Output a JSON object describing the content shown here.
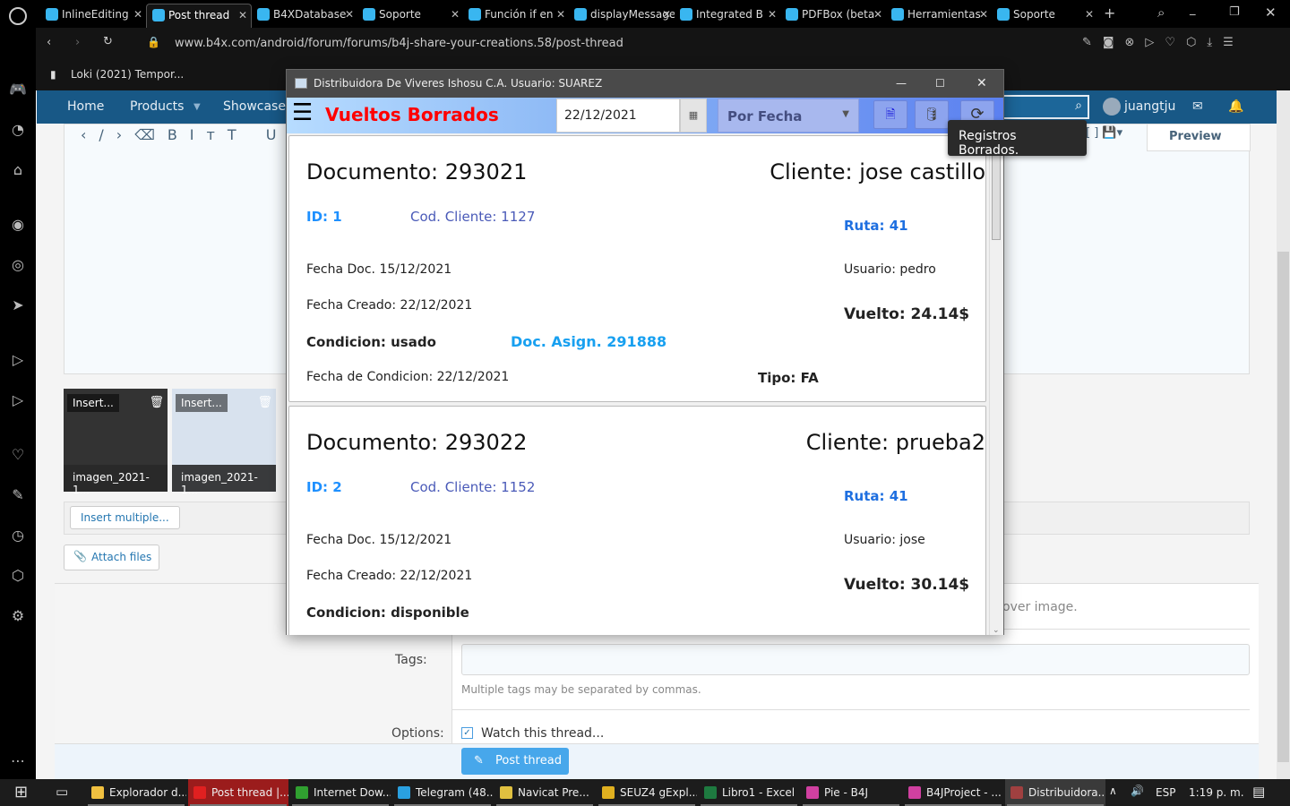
{
  "browser": {
    "tabs": [
      {
        "label": "InlineEditing",
        "icon": "b4x-icon"
      },
      {
        "label": "Post thread",
        "icon": "b4x-icon",
        "active": true
      },
      {
        "label": "B4XDatabase",
        "icon": "b4x-icon"
      },
      {
        "label": "Soporte",
        "icon": "soporte-icon"
      },
      {
        "label": "Función if en",
        "icon": "avatar-icon"
      },
      {
        "label": "displayMessage",
        "icon": "b4x-icon"
      },
      {
        "label": "Integrated B",
        "icon": "b4x-icon"
      },
      {
        "label": "PDFBox (beta",
        "icon": "b4x-icon"
      },
      {
        "label": "Herramientas",
        "icon": "tool-icon"
      },
      {
        "label": "Soporte",
        "icon": "soporte-icon"
      }
    ],
    "url": "www.b4x.com/android/forum/forums/b4j-share-your-creations.58/post-thread",
    "bookmark": "Loki (2021) Tempor..."
  },
  "forum": {
    "nav": [
      "Home",
      "Products",
      "Showcase"
    ],
    "user": "juangtju",
    "preview": "Preview",
    "thumbs": [
      {
        "badge": "Insert...",
        "name": "imagen_2021-1..."
      },
      {
        "badge": "Insert...",
        "name": "imagen_2021-1..."
      }
    ],
    "insert_multiple": "Insert multiple...",
    "attach_files": "Attach files",
    "cover_hint": "over image.",
    "tags_label": "Tags:",
    "tags_value": "",
    "tags_hint": "Multiple tags may be separated by commas.",
    "options_label": "Options:",
    "watch_label": "Watch this thread...",
    "watch_checked": true,
    "post_button": "Post thread"
  },
  "dialog": {
    "title": "Distribuidora De Viveres Ishosu C.A. Usuario:   SUAREZ",
    "heading": "Vueltos Borrados",
    "date": "22/12/2021",
    "filter": "Por Fecha",
    "tooltip": "Registros Borrados.",
    "colors": {
      "heading": "#ff0000",
      "id": "#1e90ff",
      "cod": "#4a5ab8"
    },
    "records": [
      {
        "doc": "Documento: 293021",
        "cliente": "Cliente: jose castillo",
        "id": "ID: 1",
        "cod": "Cod. Cliente: 1127",
        "ruta": "Ruta: 41",
        "fecha_doc": "Fecha Doc. 15/12/2021",
        "usuario": "Usuario: pedro",
        "fecha_creado": "Fecha Creado: 22/12/2021",
        "vuelto": "Vuelto: 24.14$",
        "condicion": "Condicion: usado",
        "asign": "Doc. Asign. 291888",
        "fecha_cond": "Fecha de Condicion: 22/12/2021",
        "tipo": "Tipo: FA"
      },
      {
        "doc": "Documento: 293022",
        "cliente": "Cliente: prueba2",
        "id": "ID: 2",
        "cod": "Cod. Cliente: 1152",
        "ruta": "Ruta: 41",
        "fecha_doc": "Fecha Doc. 15/12/2021",
        "usuario": "Usuario: jose",
        "fecha_creado": "Fecha Creado: 22/12/2021",
        "vuelto": "Vuelto: 30.14$",
        "condicion": "Condicion: disponible"
      }
    ]
  },
  "taskbar": {
    "items": [
      {
        "label": "Explorador d...",
        "color": "#f0c040"
      },
      {
        "label": "Post thread |...",
        "color": "#e02020",
        "active": true
      },
      {
        "label": "Internet Dow...",
        "color": "#30a030"
      },
      {
        "label": "Telegram (48...",
        "color": "#2aa0e0"
      },
      {
        "label": "Navicat Pre...",
        "color": "#e0c040"
      },
      {
        "label": "SEUZ4 gExpl...",
        "color": "#e0b020"
      },
      {
        "label": "Libro1 - Excel",
        "color": "#1e7a40"
      },
      {
        "label": "Pie - B4J",
        "color": "#d040a0"
      },
      {
        "label": "B4JProject - ...",
        "color": "#d040a0"
      },
      {
        "label": "Distribuidora...",
        "color": "#a04040"
      }
    ],
    "lang": "ESP",
    "time": "1:19 p. m."
  }
}
